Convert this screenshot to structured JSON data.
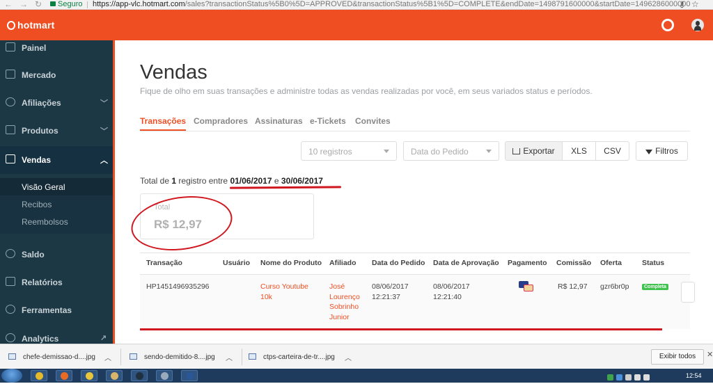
{
  "browser": {
    "secure_label": "Seguro",
    "url_host": "https://app-vlc.hotmart.com",
    "url_path": "/sales?transactionStatus%5B0%5D=APPROVED&transactionStatus%5B1%5D=COMPLETE&endDate=1498791600000&startDate=1496286000000"
  },
  "header": {
    "logo_text": "hotmart"
  },
  "sidebar": {
    "items": [
      {
        "label": "Painel",
        "icon": "dashboard-icon"
      },
      {
        "label": "Mercado",
        "icon": "market-icon"
      },
      {
        "label": "Afiliações",
        "icon": "affiliates-icon"
      },
      {
        "label": "Produtos",
        "icon": "products-icon"
      },
      {
        "label": "Vendas",
        "icon": "cart-icon"
      },
      {
        "label": "Saldo",
        "icon": "dollar-icon"
      },
      {
        "label": "Relatórios",
        "icon": "reports-icon"
      },
      {
        "label": "Ferramentas",
        "icon": "tools-icon"
      },
      {
        "label": "Analytics",
        "icon": "analytics-icon"
      }
    ],
    "vendas_sub": [
      "Visão Geral",
      "Recibos",
      "Reembolsos"
    ]
  },
  "page": {
    "title": "Vendas",
    "subtitle": "Fique de olho em suas transações e administre todas as vendas realizadas por você, em seus variados status e períodos."
  },
  "tabs": [
    "Transações",
    "Compradores",
    "Assinaturas",
    "e-Tickets",
    "Convites"
  ],
  "controls": {
    "per_page": "10 registros",
    "date_field": "Data do Pedido",
    "export": "Exportar",
    "xls": "XLS",
    "csv": "CSV",
    "filters": "Filtros"
  },
  "summary": {
    "prefix": "Total de",
    "count": "1",
    "middle": "registro entre",
    "start_date": "01/06/2017",
    "conj": "e",
    "end_date": "30/06/2017"
  },
  "total_card": {
    "label": "Total",
    "value": "R$ 12,97"
  },
  "table": {
    "headers": [
      "Transação",
      "Usuário",
      "Nome do Produto",
      "Afiliado",
      "Data do Pedido",
      "Data de Aprovação",
      "Pagamento",
      "Comissão",
      "Oferta",
      "Status"
    ],
    "row": {
      "transaction": "HP1451496935296",
      "user": "",
      "product_l1": "Curso Youtube",
      "product_l2": "10k",
      "affiliate": [
        "José",
        "Lourenço",
        "Sobrinho",
        "Junior"
      ],
      "order_date": "08/06/2017",
      "order_time": "12:21:37",
      "approval_date": "08/06/2017",
      "approval_time": "12:21:40",
      "commission": "R$ 12,97",
      "offer": "gzr6br0p",
      "status": "Completa"
    }
  },
  "downloads": {
    "files": [
      "chefe-demissao-d....jpg",
      "sendo-demitido-8....jpg",
      "ctps-carteira-de-tr....jpg"
    ],
    "show_all": "Exibir todos"
  },
  "taskbar": {
    "clock": "12:54"
  },
  "colors": {
    "brand": "#ef4e23",
    "sidebar": "#1d3845",
    "status_ok": "#3fc24e",
    "annotation": "#d0161f"
  }
}
